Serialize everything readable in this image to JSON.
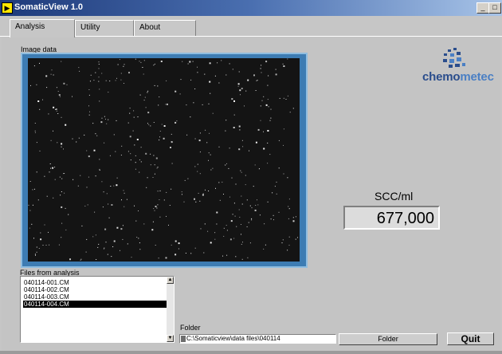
{
  "window": {
    "title": "SomaticView 1.0",
    "icon": "app-icon",
    "controls": [
      "minimize-icon",
      "maximize-icon"
    ]
  },
  "tabs": [
    {
      "label": "Analysis",
      "active": true
    },
    {
      "label": "Utility",
      "active": false
    },
    {
      "label": "About",
      "active": false
    }
  ],
  "image_panel": {
    "label": "Image data"
  },
  "logo": {
    "text_a": "chemo",
    "text_b": "metec",
    "colors": {
      "a": "#2a4d8c",
      "b": "#4a7fc4"
    }
  },
  "result": {
    "label": "SCC/ml",
    "value": "677,000"
  },
  "files": {
    "label": "Files from analysis",
    "items": [
      "040114-001.CM",
      "040114-002.CM",
      "040114-003.CM",
      "040114-004.CM"
    ],
    "selected_index": 3
  },
  "folder": {
    "label": "Folder",
    "path": "C:\\Somaticview\\data files\\040114",
    "button_label": "Folder"
  },
  "quit": {
    "label": "Quit"
  },
  "colors": {
    "frame": "#3d7cb3",
    "image_bg": "#141414"
  }
}
